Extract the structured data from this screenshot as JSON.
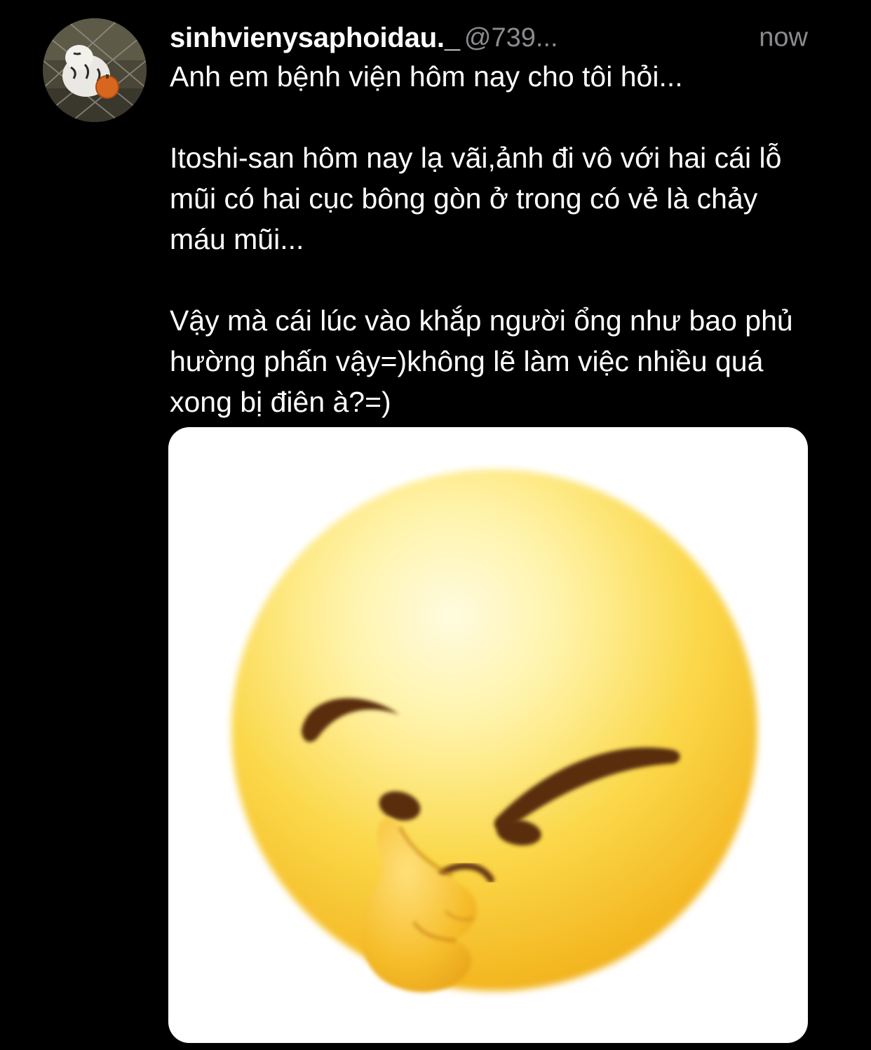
{
  "post": {
    "author": {
      "display_name": "sinhvienysaphoidau._",
      "handle": "@739...",
      "avatar_icon": "white-tiger-avatar-icon"
    },
    "timestamp": "now",
    "paragraphs": [
      "Anh em bệnh viện hôm nay cho tôi hỏi...",
      "Itoshi-san hôm nay lạ vãi,ảnh đi vô với hai cái lỗ mũi có hai cục bông gòn ở trong có vẻ là chảy máu mũi...",
      "Vậy mà cái lúc vào khắp người ổng như bao phủ hường phấn vậy=)không lẽ làm việc nhiều quá xong bị điên à?=)"
    ],
    "media": {
      "icon": "thinking-face-emoji-icon",
      "background": "#ffffff"
    }
  },
  "colors": {
    "background": "#000000",
    "text_primary": "#ffffff",
    "text_secondary": "#8b8b8f",
    "emoji_yellow": "#f7c22b",
    "emoji_highlight": "#fff6c8",
    "emoji_feature": "#5a2e0c"
  }
}
